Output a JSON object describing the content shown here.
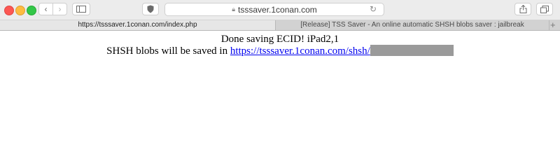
{
  "browser": {
    "address_host": "tsssaver.1conan.com",
    "icons": [
      "close-icon",
      "minimize-icon",
      "zoom-icon",
      "back-icon",
      "forward-icon",
      "sidebar-icon",
      "shield-icon",
      "lock-icon",
      "reload-icon",
      "share-icon",
      "tabs-icon",
      "plus-icon"
    ]
  },
  "tabs": [
    {
      "label": "https://tsssaver.1conan.com/index.php",
      "active": true
    },
    {
      "label": "[Release] TSS Saver - An online automatic SHSH blobs saver : jailbreak",
      "active": false
    }
  ],
  "page": {
    "status": "Done saving ECID! iPad2,1",
    "saved_prefix": "SHSH blobs will be saved in ",
    "saved_link": "https://tsssaver.1conan.com/shsh/"
  },
  "colors": {
    "link": "#0000ee",
    "redaction": "#9a9a9a"
  }
}
